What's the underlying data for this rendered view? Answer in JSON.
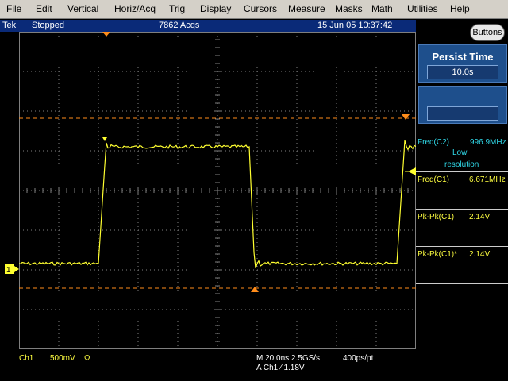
{
  "menu": [
    "File",
    "Edit",
    "Vertical",
    "Horiz/Acq",
    "Trig",
    "Display",
    "Cursors",
    "Measure",
    "Masks",
    "Math",
    "Utilities",
    "Help"
  ],
  "status": {
    "brand": "Tek",
    "state": "Stopped",
    "acqs": "7862 Acqs",
    "datetime": "15 Jun 05 10:37:42"
  },
  "buttons_label": "Buttons",
  "persist": {
    "title": "Persist Time",
    "value": "10.0s"
  },
  "measurements": {
    "freq_c2_label": "Freq(C2)",
    "freq_c2_value": "996.9MHz",
    "low_res_line1": "Low",
    "low_res_line2": "resolution",
    "freq_c1_label": "Freq(C1)",
    "freq_c1_value": "6.671MHz",
    "pkpk_c1_label": "Pk-Pk(C1)",
    "pkpk_c1_value": "2.14V",
    "pkpk_c1s_label": "Pk-Pk(C1)*",
    "pkpk_c1s_value": "2.14V"
  },
  "readout": {
    "ch": "Ch1",
    "volts": "500mV",
    "ohm": "Ω",
    "timebase": "M 20.0ns 2.5GS/s",
    "res": "400ps/pt",
    "trig": "A  Ch1  ∕  1.18V"
  },
  "colors": {
    "trace": "#ffff30",
    "cursor": "#ff8c1a",
    "grid": "#7f7f7f",
    "statusbar": "#0a2a78"
  },
  "icons": {
    "ch1_marker": "ch1-ground-marker",
    "trig_marker": "trigger-position-marker",
    "trig_level": "trigger-level-marker"
  }
}
